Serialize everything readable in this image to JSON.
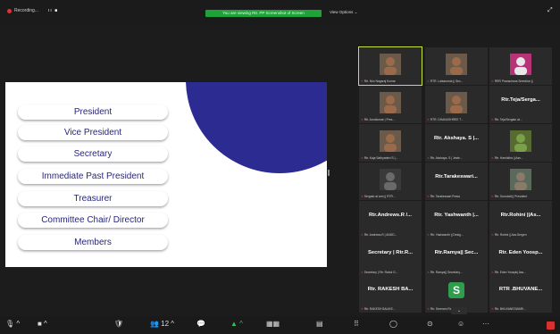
{
  "topbar": {
    "recording": "Recording...",
    "signal": "ıı  ■",
    "banner": "You are viewing Rtr. PP Screenshot of Screen",
    "view_options": "View Options ⌄",
    "expand": "⤢"
  },
  "slide": {
    "roles": [
      "President",
      "Vice President",
      "Secretary",
      "Immediate Past President",
      "Treasurer",
      "Committee Chair/ Director",
      "Members"
    ],
    "colors": {
      "circle": "#2b2b92",
      "text": "#26267d"
    }
  },
  "participants": [
    {
      "big": "",
      "label": "Rtr. Nkn Nagaraj Kumar",
      "avatar": "video-person"
    },
    {
      "big": "",
      "label": "RTR. Lalsarumia || Sec...",
      "avatar": "video-person"
    },
    {
      "big": "",
      "label": "RRR Pravachana Sreedhar ||",
      "avatar": "video-slide"
    },
    {
      "big": "",
      "label": "Rtr. Arunkumar | Pres...",
      "avatar": "video-person"
    },
    {
      "big": "",
      "label": "RTR. DHANUSHREE T...",
      "avatar": "video-person"
    },
    {
      "big": "Rtr.Teja/Serga...",
      "label": "Rtr. Teja/Sergato at...",
      "avatar": ""
    },
    {
      "big": "",
      "label": "Rtr. Kaja Sathyadevi S |...",
      "avatar": "video-person"
    },
    {
      "big": "Rtr. Akshaya. S |...",
      "label": "Rtr. Akshaya. S | Jeste...",
      "avatar": ""
    },
    {
      "big": "",
      "label": "Rtr. Harshitha || Ass...",
      "avatar": "video-plant"
    },
    {
      "big": "",
      "label": "Sergato at arm || RTR...",
      "avatar": "video-dark"
    },
    {
      "big": "Rtr.Tarakeswari...",
      "label": "Rtr. Tarakeswari Prasa",
      "avatar": ""
    },
    {
      "big": "",
      "label": "Rtr. Gurudatt || President",
      "avatar": "video-gray"
    },
    {
      "big": "Rtr.Andrews.R /...",
      "label": "Rtr. Andrews.R | ANDD...",
      "avatar": ""
    },
    {
      "big": "Rtr. Yashwanth |...",
      "label": "Rtr. Yashwanth || Desig...",
      "avatar": ""
    },
    {
      "big": "Rtr.Rohini ||As...",
      "label": "Rtr. Rohini || Ass.Sergen",
      "avatar": ""
    },
    {
      "big": "Secretary | Rtr.R...",
      "label": "Secretary | Rtr. Rahul G...",
      "avatar": ""
    },
    {
      "big": "Rtr.Ramya|| Sec...",
      "label": "Rtr. Ramya|| Secretary...",
      "avatar": ""
    },
    {
      "big": "Rtr. Eden Yoosp...",
      "label": "Rtr. Eden Yoosphj Ass...",
      "avatar": ""
    },
    {
      "big": "Rtr. RAKESH BA...",
      "label": "Rtr. RAKESH BALIKE...",
      "avatar": ""
    },
    {
      "big": "",
      "label": "Rtr. Sreeram Ramnagar...",
      "avatar": "letter-s",
      "letter": "S"
    },
    {
      "big": "RTR .BHUVANE...",
      "label": "Rtr. BHUVANESWARI...",
      "avatar": ""
    }
  ],
  "more_glyph": "⌄",
  "toolbar": {
    "icons": [
      "🎙 ^",
      "■ ^",
      "🛡",
      "👥 12 ^",
      "💬",
      "▲ ^",
      "▦▦",
      "▤",
      "⠿",
      "◯",
      "⊙",
      "☺",
      "···"
    ]
  },
  "accent": "#c8e23a"
}
